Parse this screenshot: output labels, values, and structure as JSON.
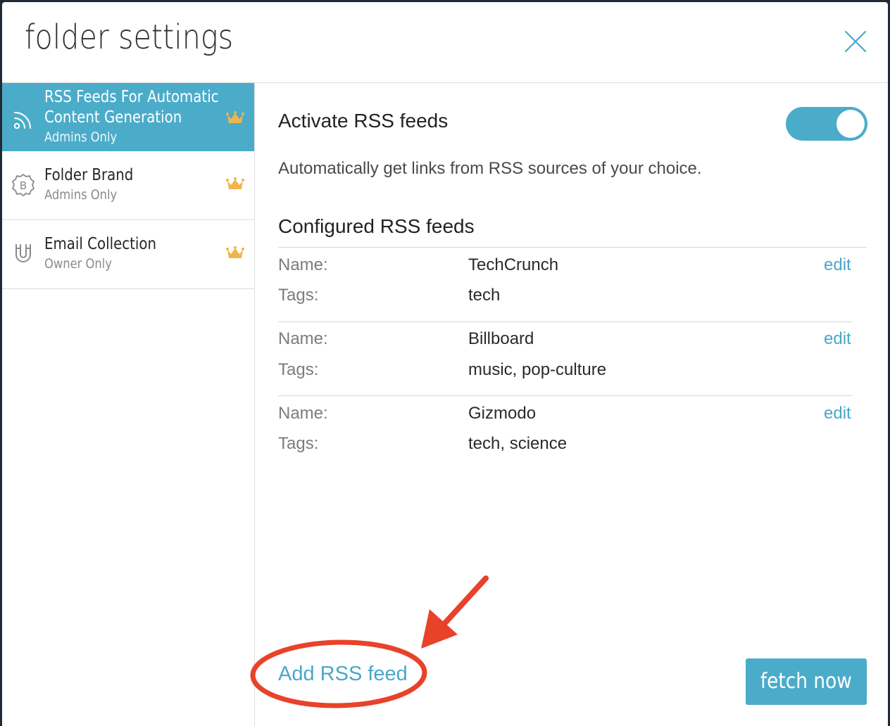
{
  "dialog": {
    "title": "folder settings"
  },
  "sidebar": {
    "items": [
      {
        "title_line1": "RSS Feeds For Automatic",
        "title_line2": "Content Generation",
        "subtitle": "Admins Only",
        "icon": "rss-icon",
        "badge_icon": "crown-icon",
        "active": true
      },
      {
        "title": "Folder Brand",
        "subtitle": "Admins Only",
        "icon": "brand-badge-icon",
        "badge_icon": "crown-icon",
        "active": false
      },
      {
        "title": "Email Collection",
        "subtitle": "Owner Only",
        "icon": "magnet-icon",
        "badge_icon": "crown-icon",
        "active": false
      }
    ]
  },
  "main": {
    "activate_label": "Activate RSS feeds",
    "activate_on": true,
    "description": "Automatically get links from RSS sources of your choice.",
    "configured_heading": "Configured RSS feeds",
    "name_label": "Name:",
    "tags_label": "Tags:",
    "edit_label": "edit",
    "feeds": [
      {
        "name": "TechCrunch",
        "tags": "tech"
      },
      {
        "name": "Billboard",
        "tags": "music, pop-culture"
      },
      {
        "name": "Gizmodo",
        "tags": "tech, science"
      }
    ],
    "add_feed_label": "Add RSS feed",
    "fetch_label": "fetch now"
  },
  "colors": {
    "accent": "#4bacca",
    "link": "#4aa7c8",
    "crown": "#f0b54a",
    "annotation": "#e8422a",
    "backdrop": "#1f2a35"
  }
}
